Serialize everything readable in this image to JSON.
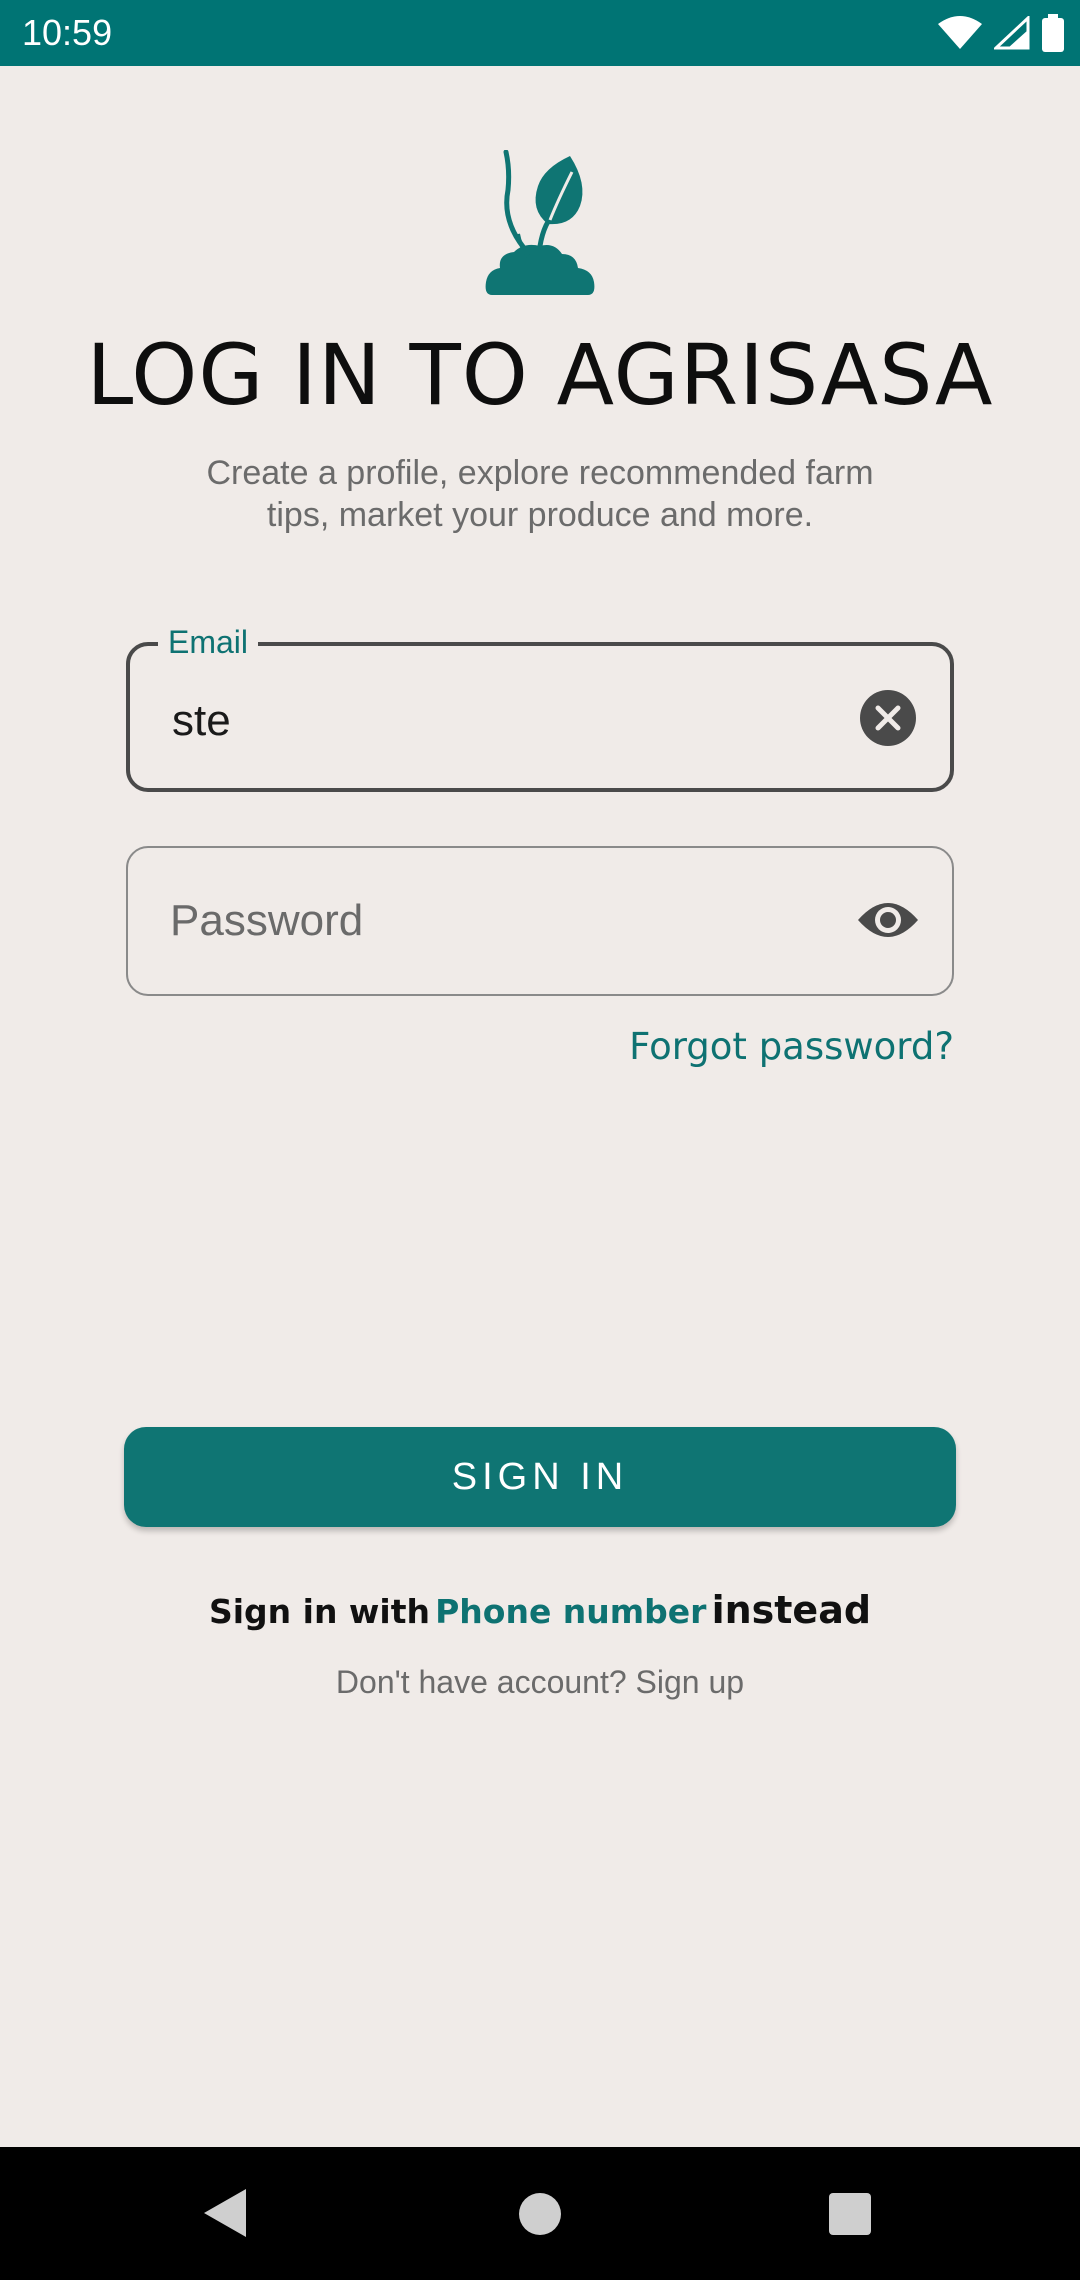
{
  "status_bar": {
    "time": "10:59",
    "icons": [
      "wifi-icon",
      "cellular-signal-icon",
      "battery-icon"
    ]
  },
  "brand": {
    "logo_icon": "plant-sprout-logo",
    "color": "#0F7573"
  },
  "title": "LOG IN TO AGRISASA",
  "subtitle_line1": "Create a profile, explore recommended farm",
  "subtitle_line2": "tips, market your produce and more.",
  "email_field": {
    "label": "Email",
    "value": "ste",
    "trailing_icon": "clear-icon"
  },
  "password_field": {
    "placeholder": "Password",
    "value": "",
    "trailing_icon": "eye-icon"
  },
  "forgot_password": "Forgot password?",
  "sign_in_button": "SIGN IN",
  "alt_sign_in": {
    "prefix": "Sign in with",
    "link": "Phone number",
    "suffix": "instead"
  },
  "signup_text": "Don't have account? Sign up",
  "nav_bar": {
    "buttons": [
      "back-icon",
      "home-icon",
      "recents-icon"
    ]
  },
  "colors": {
    "accent": "#0E7272",
    "background": "#F0EBE8",
    "status_bar": "#007474"
  }
}
